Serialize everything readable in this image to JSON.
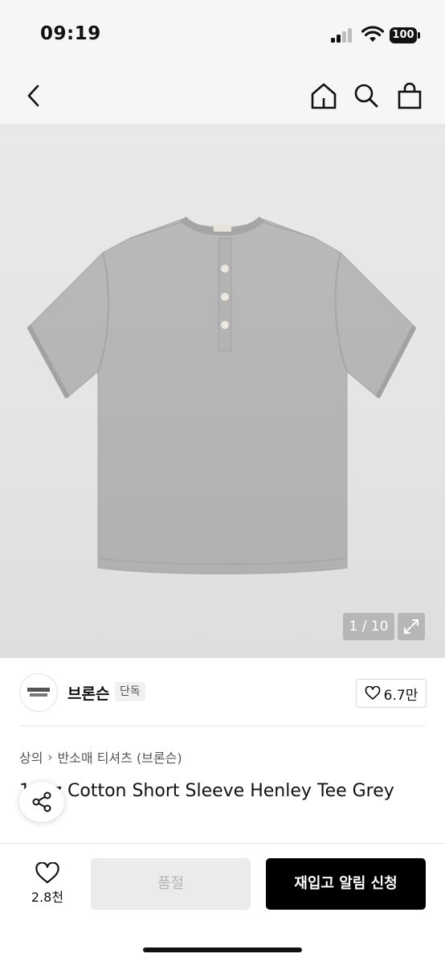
{
  "status_bar": {
    "time": "09:19",
    "battery": "100"
  },
  "nav": {
    "back_icon": "chevron-left-icon",
    "home_icon": "home-icon",
    "search_icon": "search-icon",
    "cart_icon": "shopping-bag-icon"
  },
  "gallery": {
    "counter": "1 / 10",
    "expand_icon": "expand-icon",
    "background_color": "#e5e5e5"
  },
  "brand": {
    "name": "브론슨",
    "badge": "단독",
    "likes": "6.7만"
  },
  "breadcrumb": {
    "items": [
      "상의",
      "반소매 티셔츠 (브론슨)"
    ]
  },
  "product": {
    "title": "10oz Cotton Short Sleeve Henley Tee Grey"
  },
  "bottom_bar": {
    "wish_count": "2.8천",
    "soldout_label": "품절",
    "restock_label": "재입고 알림 신청",
    "primary_color": "#000000"
  }
}
